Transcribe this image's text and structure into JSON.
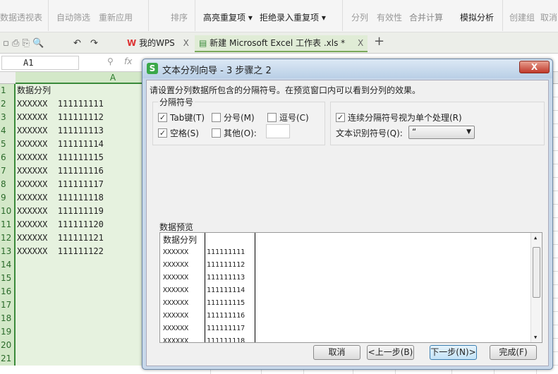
{
  "ribbon": {
    "items": [
      "数据透视表",
      "自动筛选",
      "重新应用",
      "排序",
      "高亮重复项 ▾",
      "拒绝录入重复项 ▾",
      "分列",
      "有效性",
      "合并计算",
      "模拟分析",
      "创建组",
      "取消"
    ]
  },
  "tabs": {
    "wps": "我的WPS",
    "file": "新建 Microsoft Excel 工作表 .xls *",
    "close": "X",
    "new": "+"
  },
  "formula": {
    "namebox": "A1",
    "fx": "fx"
  },
  "sheet": {
    "col_a": "A",
    "rows": [
      {
        "n": "1",
        "a": "数据分列"
      },
      {
        "n": "2",
        "a": "XXXXXX  111111111"
      },
      {
        "n": "3",
        "a": "XXXXXX  111111112"
      },
      {
        "n": "4",
        "a": "XXXXXX  111111113"
      },
      {
        "n": "5",
        "a": "XXXXXX  111111114"
      },
      {
        "n": "6",
        "a": "XXXXXX  111111115"
      },
      {
        "n": "7",
        "a": "XXXXXX  111111116"
      },
      {
        "n": "8",
        "a": "XXXXXX  111111117"
      },
      {
        "n": "9",
        "a": "XXXXXX  111111118"
      },
      {
        "n": "10",
        "a": "XXXXXX  111111119"
      },
      {
        "n": "11",
        "a": "XXXXXX  111111120"
      },
      {
        "n": "12",
        "a": "XXXXXX  111111121"
      },
      {
        "n": "13",
        "a": "XXXXXX  111111122"
      },
      {
        "n": "14",
        "a": ""
      },
      {
        "n": "15",
        "a": ""
      },
      {
        "n": "16",
        "a": ""
      },
      {
        "n": "17",
        "a": ""
      },
      {
        "n": "18",
        "a": ""
      },
      {
        "n": "19",
        "a": ""
      },
      {
        "n": "20",
        "a": ""
      },
      {
        "n": "21",
        "a": ""
      }
    ]
  },
  "dialog": {
    "title": "文本分列向导 - 3 步骤之 2",
    "close": "X",
    "instruction": "请设置分列数据所包含的分隔符号。在预览窗口内可以看到分列的效果。",
    "delim_group": "分隔符号",
    "tab": "Tab键(T)",
    "semicolon": "分号(M)",
    "comma": "逗号(C)",
    "space": "空格(S)",
    "other": "其他(O):",
    "consecutive": "连续分隔符号视为单个处理(R)",
    "qualifier_label": "文本识别符号(Q):",
    "qualifier_value": "“",
    "checked": {
      "tab": true,
      "semicolon": false,
      "comma": false,
      "space": true,
      "other": false,
      "consecutive": true
    },
    "preview_label": "数据预览",
    "preview": [
      [
        "数据分列",
        ""
      ],
      [
        "XXXXXX",
        "111111111"
      ],
      [
        "XXXXXX",
        "111111112"
      ],
      [
        "XXXXXX",
        "111111113"
      ],
      [
        "XXXXXX",
        "111111114"
      ],
      [
        "XXXXXX",
        "111111115"
      ],
      [
        "XXXXXX",
        "111111116"
      ],
      [
        "XXXXXX",
        "111111117"
      ],
      [
        "XXXXXX",
        "111111118"
      ]
    ],
    "buttons": {
      "cancel": "取消",
      "back": "<上一步(B)",
      "next": "下一步(N)>",
      "finish": "完成(F)"
    }
  }
}
